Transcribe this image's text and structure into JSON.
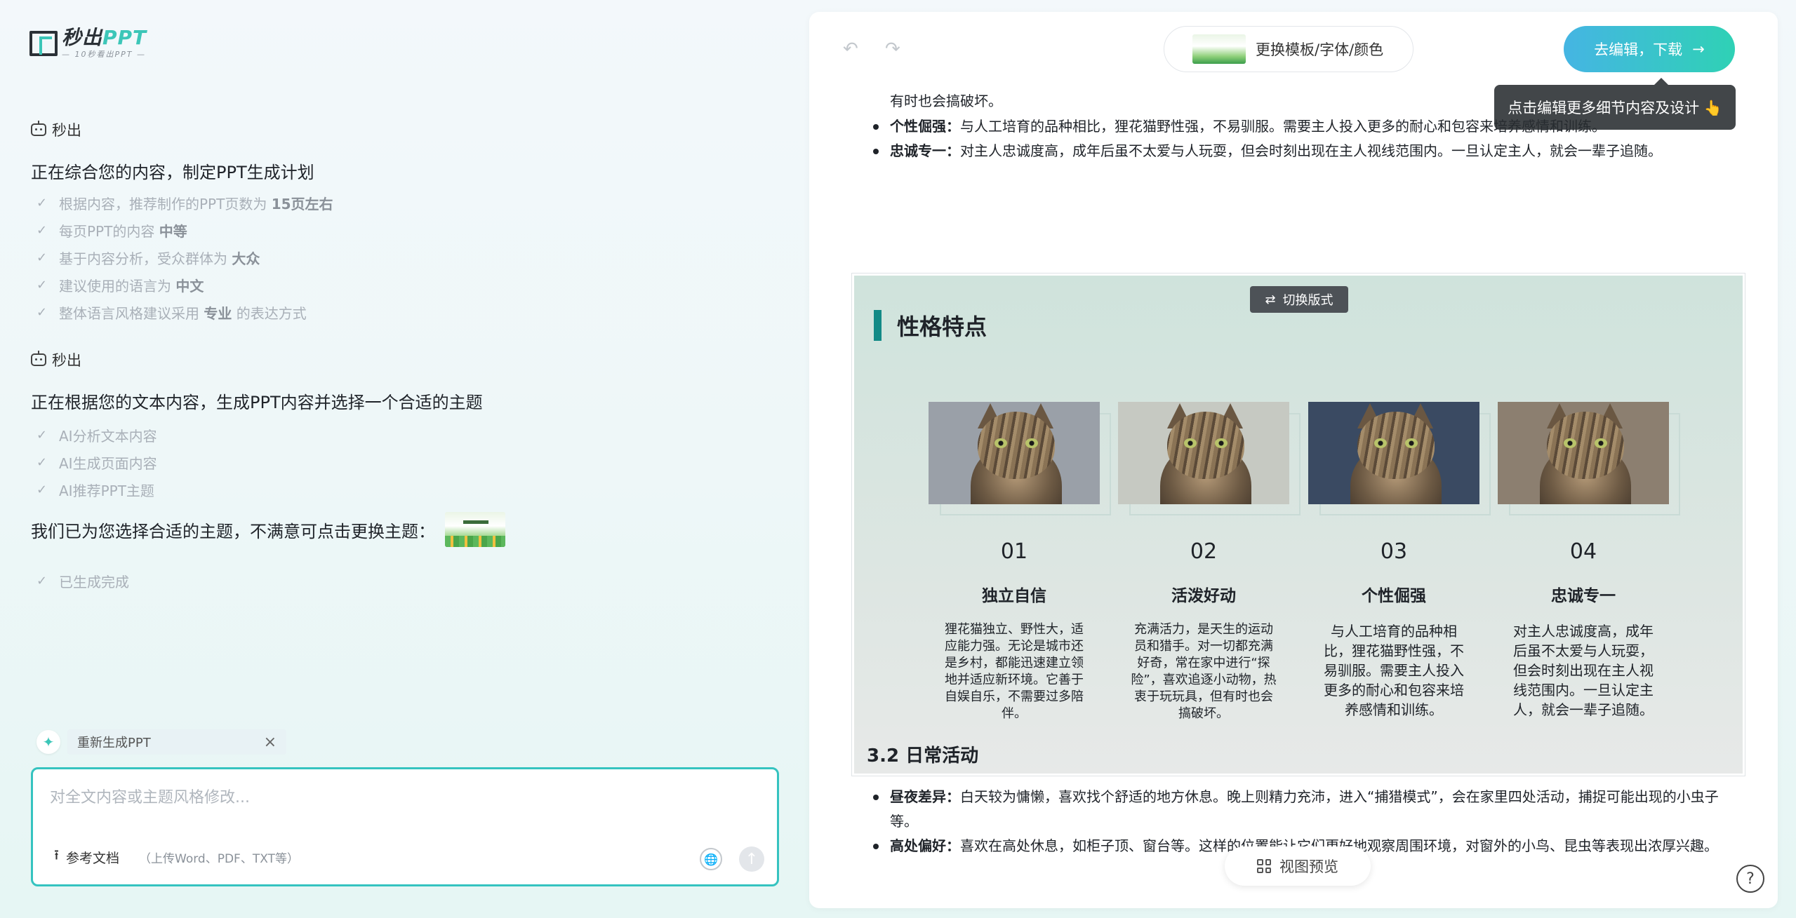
{
  "logo": {
    "title_a": "秒出",
    "title_b": "PPT",
    "subtitle": "— 10秒看出PPT —"
  },
  "chat": {
    "agent_name": "秒出",
    "step1": {
      "title": "正在综合您的内容，制定PPT生成计划",
      "items": [
        {
          "text": "根据内容，推荐制作的PPT页数为 ",
          "bold": "15页左右",
          "tail": ""
        },
        {
          "text": "每页PPT的内容 ",
          "bold": "中等",
          "tail": ""
        },
        {
          "text": "基于内容分析，受众群体为 ",
          "bold": "大众",
          "tail": ""
        },
        {
          "text": "建议使用的语言为 ",
          "bold": "中文",
          "tail": ""
        },
        {
          "text": "整体语言风格建议采用 ",
          "bold": "专业",
          "tail": " 的表达方式"
        }
      ]
    },
    "step2": {
      "title": "正在根据您的文本内容，生成PPT内容并选择一个合适的主题",
      "items": [
        "AI分析文本内容",
        "AI生成页面内容",
        "AI推荐PPT主题"
      ]
    },
    "theme_text": "我们已为您选择合适的主题，不满意可点击更换主题：",
    "done_text": "已生成完成"
  },
  "composer": {
    "chip_label": "重新生成PPT",
    "placeholder": "对全文内容或主题风格修改...",
    "upload_label": "参考文档",
    "upload_hint": "（上传Word、PDF、TXT等）"
  },
  "toolbar": {
    "change_template": "更换模板/字体/颜色",
    "edit_download": "去编辑，下载",
    "tooltip": "点击编辑更多细节内容及设计 👆"
  },
  "doc": {
    "cont_line": "有时也会搞破坏。",
    "bullets_top": [
      {
        "label": "个性倔强：",
        "text": "与人工培育的品种相比，狸花猫野性强，不易驯服。需要主人投入更多的耐心和包容来培养感情和训练。"
      },
      {
        "label": "忠诚专一：",
        "text": "对主人忠诚度高，成年后虽不太爱与人玩耍，但会时刻出现在主人视线范围内。一旦认定主人，就会一辈子追随。"
      }
    ],
    "section_title": "3.2 日常活动",
    "bullets_bottom": [
      {
        "label": "昼夜差异：",
        "text": "白天较为慵懒，喜欢找个舒适的地方休息。晚上则精力充沛，进入“捕猎模式”，会在家里四处活动，捕捉可能出现的小虫子等。"
      },
      {
        "label": "高处偏好：",
        "text": "喜欢在高处休息，如柜子顶、窗台等。这样的位置能让它们更好地观察周围环境，对窗外的小鸟、昆虫等表现出浓厚兴趣。"
      }
    ]
  },
  "slide": {
    "switch_label": "切换版式",
    "title": "性格特点",
    "cards": [
      {
        "num": "01",
        "head": "独立自信",
        "text": "狸花猫独立、野性大，适应能力强。无论是城市还是乡村，都能迅速建立领地并适应新环境。它善于自娱自乐，不需要过多陪伴。",
        "bg": "#9aa0a8"
      },
      {
        "num": "02",
        "head": "活泼好动",
        "text": "充满活力，是天生的运动员和猎手。对一切都充满好奇，常在家中进行“探险”，喜欢追逐小动物，热衷于玩玩具，但有时也会搞破坏。",
        "bg": "#c6c9c2"
      },
      {
        "num": "03",
        "head": "个性倔强",
        "text": "与人工培育的品种相比，狸花猫野性强，不易驯服。需要主人投入更多的耐心和包容来培养感情和训练。",
        "bg": "#3a4a62"
      },
      {
        "num": "04",
        "head": "忠诚专一",
        "text": "对主人忠诚度高，成年后虽不太爱与人玩耍，但会时刻出现在主人视线范围内。一旦认定主人，就会一辈子追随。",
        "bg": "#8c7f70"
      }
    ]
  },
  "view_preview": "视图预览",
  "icons": {
    "help": "help-icon",
    "undo": "undo-icon",
    "redo": "redo-icon"
  },
  "colors": {
    "accent": "#35c3c0",
    "title_bar": "#138a86"
  }
}
